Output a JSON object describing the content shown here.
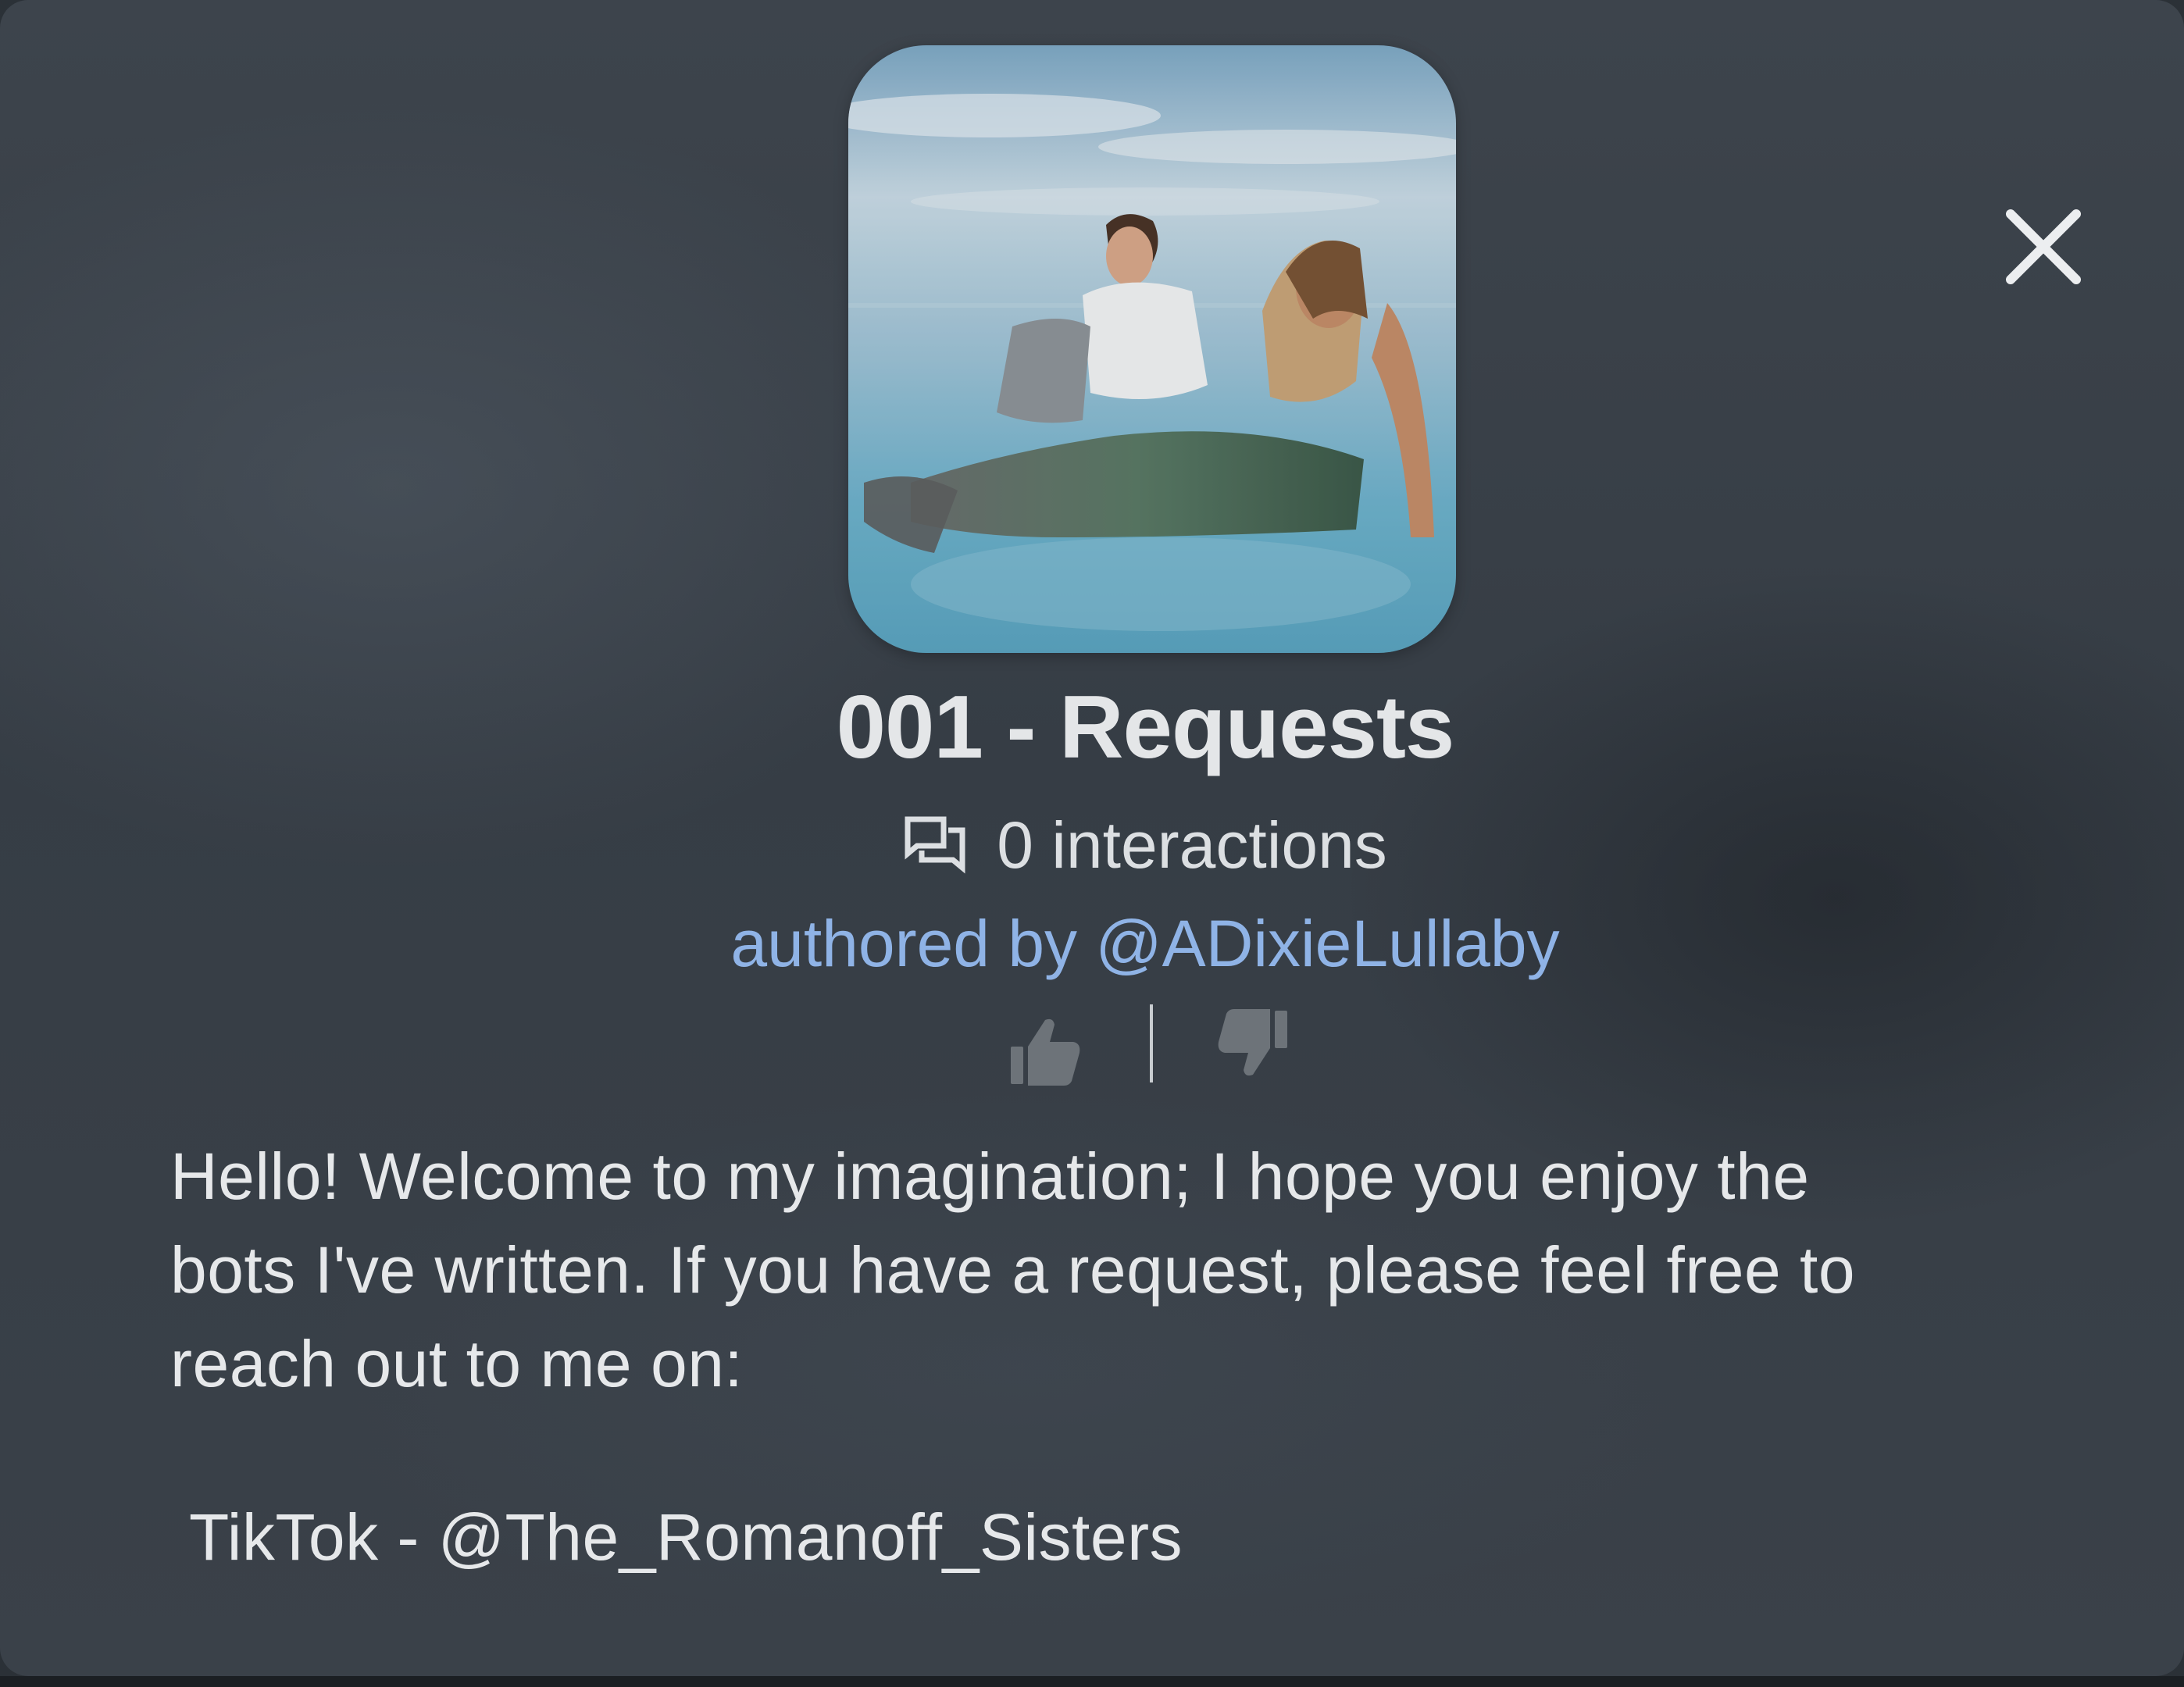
{
  "character": {
    "avatar_icon": "character-avatar-image",
    "title": "001 - Requests",
    "interactions_count": "0 interactions",
    "interactions_icon": "chat-bubbles-icon",
    "author": "authored by @ADixieLullaby"
  },
  "rating": {
    "like_icon": "thumbs-up-icon",
    "dislike_icon": "thumbs-down-icon"
  },
  "description": {
    "lines": [
      "Hello! Welcome to my imagination; I hope you enjoy the",
      "bots I've written. If you have a request, please feel free to",
      "reach out to me on:"
    ],
    "social": "TikTok - @The_Romanoff_Sisters"
  },
  "close": {
    "icon": "close-icon"
  },
  "colors": {
    "background": "#3a4148",
    "text": "#e6e8ea",
    "link": "#8fb3e6"
  }
}
